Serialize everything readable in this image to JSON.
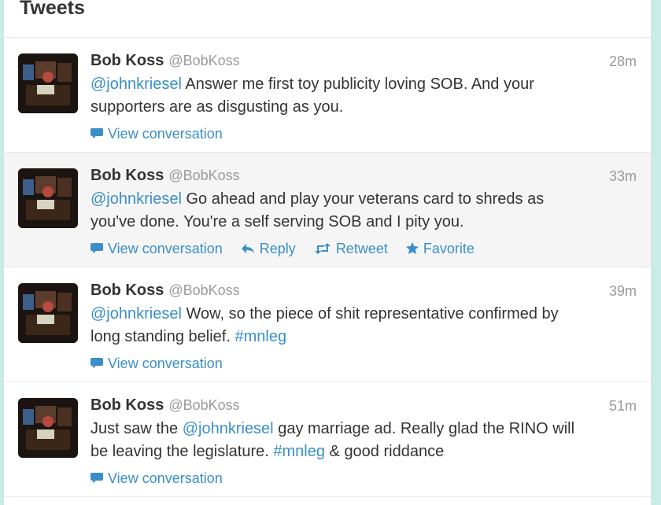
{
  "header": {
    "title": "Tweets"
  },
  "icons": [
    "speech-bubble-icon",
    "reply-arrow-icon",
    "retweet-icon",
    "star-icon"
  ],
  "colors": {
    "link": "#3a8fc8",
    "name": "#333333",
    "muted": "#999999"
  },
  "actions": {
    "view_conversation": "View conversation",
    "reply": "Reply",
    "retweet": "Retweet",
    "favorite": "Favorite"
  },
  "tweets": [
    {
      "name": "Bob Koss",
      "handle": "@BobKoss",
      "time": "28m",
      "line1_mention": "@johnkriesel",
      "line1_rest": " Answer me first toy publicity loving SOB. And your",
      "line2": "supporters are as disgusting as you."
    },
    {
      "name": "Bob Koss",
      "handle": "@BobKoss",
      "time": "33m",
      "line1_mention": "@johnkriesel",
      "line1_rest": " Go ahead and play your veterans card to shreds as",
      "line2": "you've done. You're a self serving SOB and I pity you."
    },
    {
      "name": "Bob Koss",
      "handle": "@BobKoss",
      "time": "39m",
      "line1_mention": "@johnkriesel",
      "line1_rest": " Wow, so the piece of shit representative confirmed by",
      "line2_text": "long standing belief. ",
      "line2_hashtag": "#mnleg"
    },
    {
      "name": "Bob Koss",
      "handle": "@BobKoss",
      "time": "51m",
      "line1_pre": "Just saw the ",
      "line1_mention": "@johnkriesel",
      "line1_rest": " gay marriage ad. Really glad the RINO will",
      "line2_text": "be leaving the legislature. ",
      "line2_hashtag": "#mnleg",
      "line2_rest": " & good riddance"
    }
  ]
}
